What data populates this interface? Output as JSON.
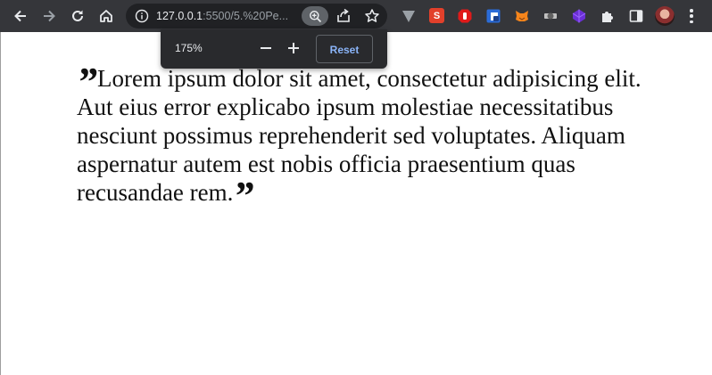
{
  "browser": {
    "url_host": "127.0.0.1",
    "url_rest": ":5500/5.%20Pe..."
  },
  "zoom_popup": {
    "level": "175%",
    "reset_label": "Reset"
  },
  "icons": {
    "back": "arrow-left-icon",
    "forward": "arrow-right-icon",
    "reload": "reload-icon",
    "home": "home-icon",
    "site_info": "info-icon",
    "zoom": "zoom-icon",
    "share": "share-icon",
    "bookmark": "star-icon",
    "extensions": [
      "vivaldi-extension-icon",
      "svelte-extension-icon",
      "adblock-extension-icon",
      "tracker-extension-icon",
      "metamask-extension-icon",
      "gear-extension-icon",
      "purple-cube-extension-icon",
      "puzzle-extension-icon"
    ],
    "side_panel": "side-panel-icon",
    "menu": "kebab-menu-icon"
  },
  "content": {
    "open_quote": "”",
    "close_quote": "”",
    "quote_text": "Lorem ipsum dolor sit amet, consectetur adipisicing elit. Aut eius error explicabo ipsum molestiae necessitatibus nesciunt possimus reprehenderit sed voluptates. Aliquam aspernatur autem est nobis officia praesentium quas recusandae rem."
  },
  "colors": {
    "toolbar_bg": "#35363a",
    "omnibox_bg": "#202124",
    "popup_bg": "#292a2d",
    "accent": "#8ab4f8"
  }
}
